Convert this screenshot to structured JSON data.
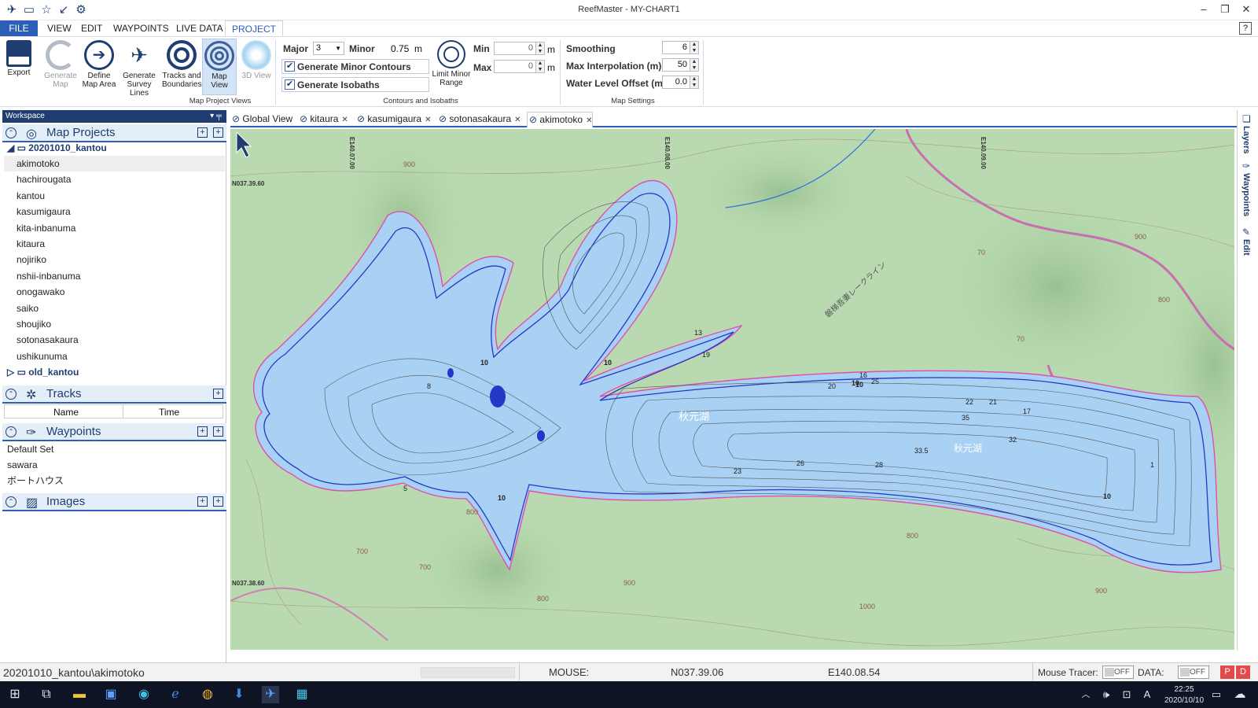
{
  "window": {
    "title": "ReefMaster - MY-CHART1",
    "quick_access": [
      "app-icon",
      "open-folder-icon",
      "star-icon",
      "back-icon",
      "gear-icon"
    ],
    "minimize": "–",
    "restore": "❐",
    "close": "✕"
  },
  "menu": {
    "file": "FILE",
    "view": "VIEW",
    "edit": "EDIT",
    "waypoints": "WAYPOINTS",
    "live_data": "LIVE DATA",
    "project": "PROJECT",
    "help": "?"
  },
  "ribbon": {
    "export": "Export",
    "generate_map": "Generate Map",
    "define_map_area": "Define Map Area",
    "generate_survey_lines": "Generate Survey Lines",
    "tracks_and_boundaries": "Tracks and Boundaries",
    "map_view": "Map View",
    "view_3d": "3D View",
    "group_map_project_views": "Map Project Views",
    "major_label": "Major",
    "major_value": "3",
    "minor_label": "Minor",
    "minor_value": "0.75",
    "minor_unit": "m",
    "generate_minor_contours": "Generate Minor Contours",
    "generate_isobaths": "Generate Isobaths",
    "limit_minor_range": "Limit Minor Range",
    "min_label": "Min",
    "min_value": "0",
    "max_label": "Max",
    "max_value": "0",
    "m_unit": "m",
    "group_contours": "Contours and Isobaths",
    "smoothing_label": "Smoothing",
    "smoothing_value": "6",
    "max_interp_label": "Max Interpolation (m)",
    "max_interp_value": "50",
    "water_offset_label": "Water Level Offset (m)",
    "water_offset_value": "0.0",
    "group_map_settings": "Map Settings"
  },
  "workspace": {
    "title": "Workspace",
    "pin": "▾ ╤",
    "map_projects": "Map Projects",
    "folder_open": "20201010_kantou",
    "projects": [
      "akimotoko",
      "hachirougata",
      "kantou",
      "kasumigaura",
      "kita-inbanuma",
      "kitaura",
      "nojiriko",
      "nshii-inbanuma",
      "onogawako",
      "saiko",
      "shoujiko",
      "sotonasakaura",
      "ushikunuma"
    ],
    "folder_closed": "old_kantou",
    "tracks": "Tracks",
    "col_name": "Name",
    "col_time": "Time",
    "waypoints": "Waypoints",
    "waypoint_sets": [
      "Default Set",
      "sawara",
      "ボートハウス"
    ],
    "images": "Images"
  },
  "tabs": [
    {
      "label": "Global View",
      "closable": false
    },
    {
      "label": "kitaura",
      "closable": true
    },
    {
      "label": "kasumigaura",
      "closable": true
    },
    {
      "label": "sotonasakaura",
      "closable": true
    },
    {
      "label": "akimotoko",
      "closable": true,
      "active": true
    }
  ],
  "map": {
    "lon_labels": [
      "E140.07.00",
      "E140.08.00",
      "E140.09.00"
    ],
    "lat_labels": [
      "N037.39.60",
      "N037.38.60"
    ],
    "depth_labels": [
      "10",
      "10",
      "10",
      "10",
      "10",
      "10",
      "13",
      "16",
      "19",
      "20",
      "25",
      "22",
      "21",
      "17",
      "35",
      "33.5",
      "32",
      "28",
      "26",
      "23",
      "8",
      "5",
      "1"
    ],
    "elev_labels": [
      "900",
      "800",
      "700",
      "800",
      "900",
      "1000",
      "800",
      "900",
      "70",
      "70",
      "900",
      "800",
      "700"
    ],
    "road_label": "磐梯吾妻レークライン",
    "lake_labels": [
      "秋元湖",
      "秋元湖"
    ],
    "colors": {
      "land": "#b9dab0",
      "water": "#a9d1f3",
      "contour": "#555555",
      "shore_pink": "#e04fb0",
      "shore_blue": "#2438c8"
    }
  },
  "rail": {
    "layers": "Layers",
    "waypoints": "Waypoints",
    "edit": "Edit"
  },
  "status": {
    "path": "20201010_kantou\\akimotoko",
    "mouse_label": "MOUSE:",
    "lat": "N037.39.06",
    "lon": "E140.08.54",
    "tracer_label": "Mouse Tracer:",
    "tracer_state": "OFF",
    "data_label": "DATA:",
    "data_state": "OFF",
    "p": "P",
    "d": "D"
  },
  "taskbar": {
    "time": "22:25",
    "date": "2020/10/10",
    "ime": "A"
  }
}
